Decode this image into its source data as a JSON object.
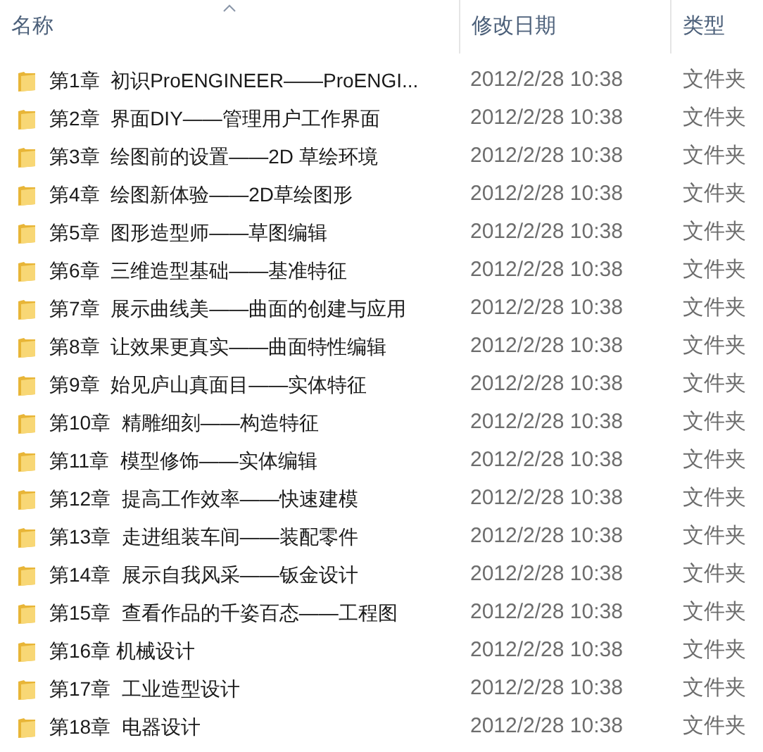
{
  "columns": [
    {
      "label": "名称",
      "sorted": true
    },
    {
      "label": "修改日期",
      "sorted": false
    },
    {
      "label": "类型",
      "sorted": false
    }
  ],
  "rows": [
    {
      "name": "第1章  初识ProENGINEER——ProENGI...",
      "modified": "2012/2/28 10:38",
      "type": "文件夹"
    },
    {
      "name": "第2章  界面DIY——管理用户工作界面",
      "modified": "2012/2/28 10:38",
      "type": "文件夹"
    },
    {
      "name": "第3章  绘图前的设置——2D 草绘环境",
      "modified": "2012/2/28 10:38",
      "type": "文件夹"
    },
    {
      "name": "第4章  绘图新体验——2D草绘图形",
      "modified": "2012/2/28 10:38",
      "type": "文件夹"
    },
    {
      "name": "第5章  图形造型师——草图编辑",
      "modified": "2012/2/28 10:38",
      "type": "文件夹"
    },
    {
      "name": "第6章  三维造型基础——基准特征",
      "modified": "2012/2/28 10:38",
      "type": "文件夹"
    },
    {
      "name": "第7章  展示曲线美——曲面的创建与应用",
      "modified": "2012/2/28 10:38",
      "type": "文件夹"
    },
    {
      "name": "第8章  让效果更真实——曲面特性编辑",
      "modified": "2012/2/28 10:38",
      "type": "文件夹"
    },
    {
      "name": "第9章  始见庐山真面目——实体特征",
      "modified": "2012/2/28 10:38",
      "type": "文件夹"
    },
    {
      "name": "第10章  精雕细刻——构造特征",
      "modified": "2012/2/28 10:38",
      "type": "文件夹"
    },
    {
      "name": "第11章  模型修饰——实体编辑",
      "modified": "2012/2/28 10:38",
      "type": "文件夹"
    },
    {
      "name": "第12章  提高工作效率——快速建模",
      "modified": "2012/2/28 10:38",
      "type": "文件夹"
    },
    {
      "name": "第13章  走进组装车间——装配零件",
      "modified": "2012/2/28 10:38",
      "type": "文件夹"
    },
    {
      "name": "第14章  展示自我风采——钣金设计",
      "modified": "2012/2/28 10:38",
      "type": "文件夹"
    },
    {
      "name": "第15章  查看作品的千姿百态——工程图",
      "modified": "2012/2/28 10:38",
      "type": "文件夹"
    },
    {
      "name": "第16章 机械设计",
      "modified": "2012/2/28 10:38",
      "type": "文件夹"
    },
    {
      "name": "第17章  工业造型设计",
      "modified": "2012/2/28 10:38",
      "type": "文件夹"
    },
    {
      "name": "第18章  电器设计",
      "modified": "2012/2/28 10:38",
      "type": "文件夹"
    }
  ]
}
